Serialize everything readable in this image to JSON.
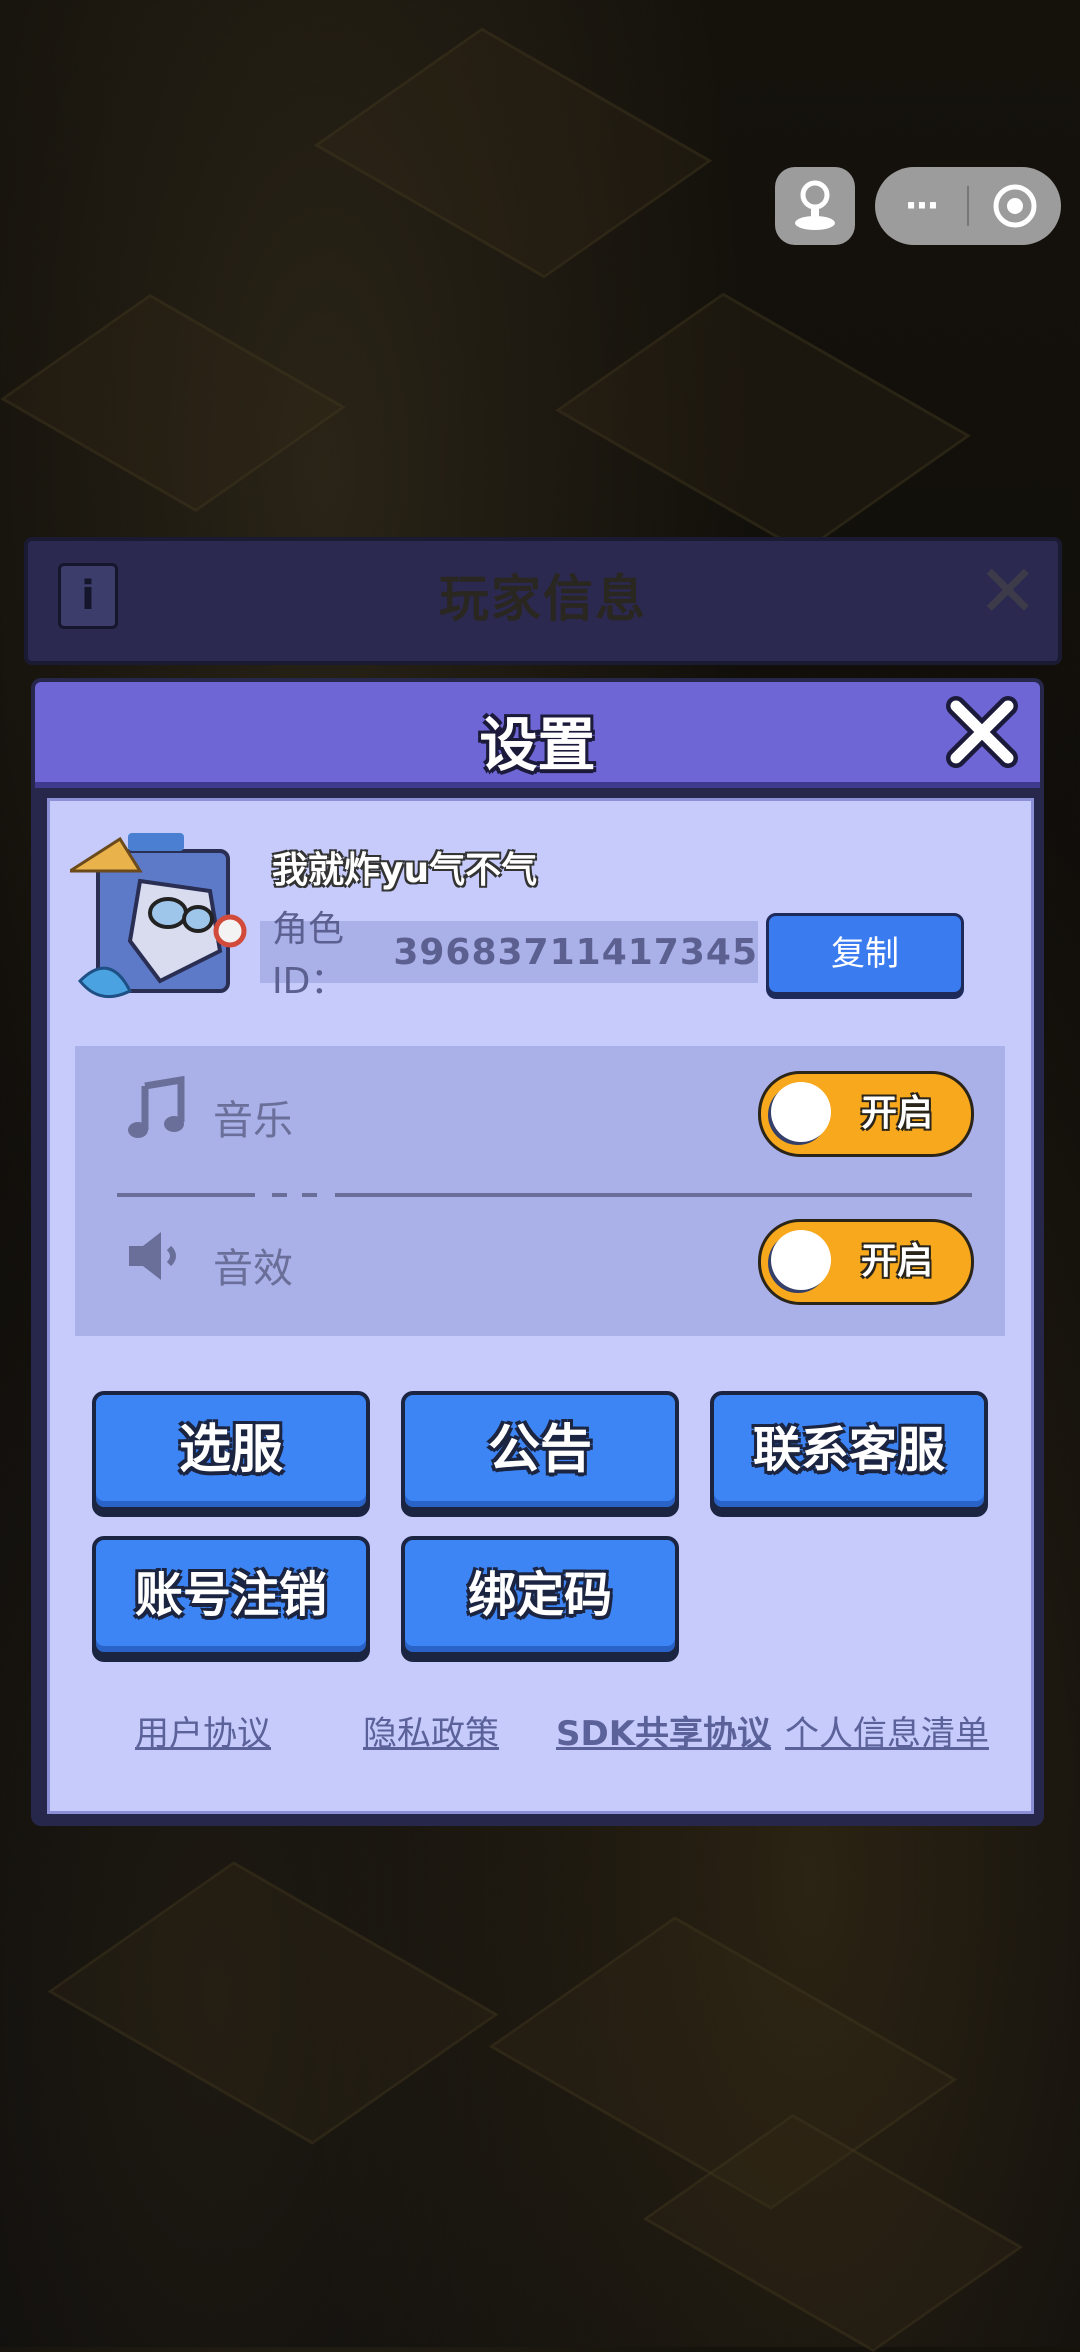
{
  "capsule": {
    "more_glyph": "···"
  },
  "background_panel": {
    "info_glyph": "i",
    "title": "玩家信息",
    "close_glyph": "✕"
  },
  "dialog": {
    "title": "设置",
    "profile": {
      "nickname": "我就炸yu气不气",
      "id_label": "角色ID：",
      "id_value": "39683711417345",
      "copy_label": "复制"
    },
    "audio": [
      {
        "icon": "music-note-icon",
        "label": "音乐",
        "state": "开启",
        "on": true
      },
      {
        "icon": "speaker-icon",
        "label": "音效",
        "state": "开启",
        "on": true
      }
    ],
    "buttons": [
      "选服",
      "公告",
      "联系客服",
      "账号注销",
      "绑定码"
    ],
    "links": [
      "用户协议",
      "隐私政策",
      "SDK共享协议",
      "个人信息清单"
    ]
  },
  "colors": {
    "header": "#6e66d4",
    "body": "#c6cbfc",
    "button": "#3d85f5",
    "toggle_on": "#f7a81c"
  }
}
